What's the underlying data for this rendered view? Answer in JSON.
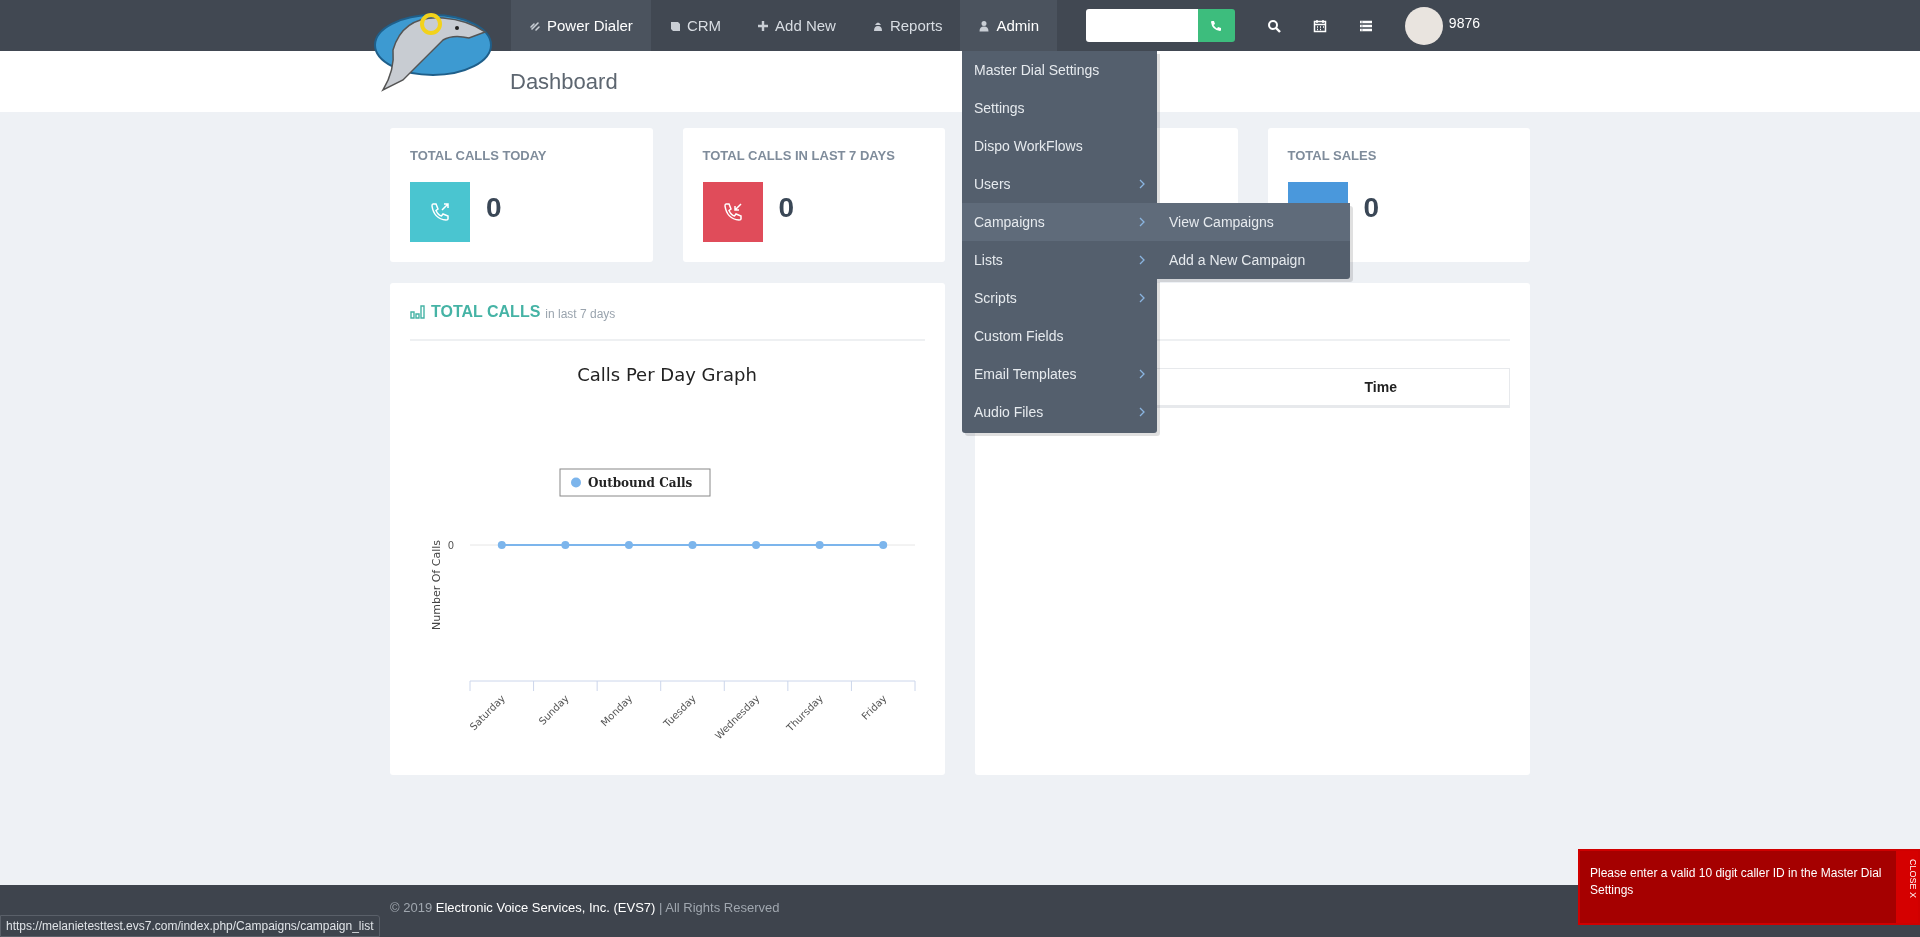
{
  "nav": {
    "items": [
      {
        "label": "Power Dialer",
        "selected": true
      },
      {
        "label": "CRM",
        "selected": false
      },
      {
        "label": "Add New",
        "selected": false
      },
      {
        "label": "Reports",
        "selected": false
      },
      {
        "label": "Admin",
        "selected": true
      }
    ],
    "user": {
      "name": "9876"
    }
  },
  "page_title": "Dashboard",
  "stats": [
    {
      "kind": "outgoing",
      "title": "TOTAL CALLS TODAY",
      "value": "0",
      "color": "#4ac5d0"
    },
    {
      "kind": "incoming",
      "title": "TOTAL CALLS IN LAST 7 DAYS",
      "value": "0",
      "color": "#e04c5a"
    },
    {
      "kind": "covered"
    },
    {
      "kind": "plain",
      "title": "TOTAL SALES",
      "value": "0",
      "color": "#4a98dc"
    }
  ],
  "calls_panel": {
    "title": "TOTAL CALLS",
    "subtitle": "in last 7 days",
    "y_tick_label": "0",
    "graph": {
      "title": "Calls Per Day Graph",
      "y_axis_label": "Number Of Calls",
      "legend": "Outbound Calls",
      "x_labels": [
        "Saturday",
        "Sunday",
        "Monday",
        "Tuesday",
        "Wednesday",
        "Thursday",
        "Friday"
      ]
    }
  },
  "right_panel": {
    "table": {
      "columns": [
        "Time"
      ]
    }
  },
  "admin_menu": {
    "items": [
      {
        "label": "Master Dial Settings",
        "submenu": false,
        "selected": false
      },
      {
        "label": "Settings",
        "submenu": false,
        "selected": false
      },
      {
        "label": "Dispo WorkFlows",
        "submenu": false,
        "selected": false
      },
      {
        "label": "Users",
        "submenu": true,
        "selected": false
      },
      {
        "label": "Campaigns",
        "submenu": true,
        "selected": true,
        "children": [
          {
            "label": "View Campaigns",
            "selected": true
          },
          {
            "label": "Add a New Campaign",
            "selected": false
          }
        ]
      },
      {
        "label": "Lists",
        "submenu": true,
        "selected": false
      },
      {
        "label": "Scripts",
        "submenu": true,
        "selected": false
      },
      {
        "label": "Custom Fields",
        "submenu": false,
        "selected": false
      },
      {
        "label": "Email Templates",
        "submenu": true,
        "selected": false
      },
      {
        "label": "Audio Files",
        "submenu": true,
        "selected": false
      }
    ]
  },
  "footer": {
    "year": "© 2019",
    "company": "Electronic Voice Services, Inc. (EVS7)",
    "rights": "| All Rights Reserved"
  },
  "status_url": "https://melanietesttest.evs7.com/index.php/Campaigns/campaign_list",
  "toast": {
    "message": "Please enter a valid 10 digit caller ID in the Master Dial Settings",
    "close_label": "CLOSE X"
  }
}
